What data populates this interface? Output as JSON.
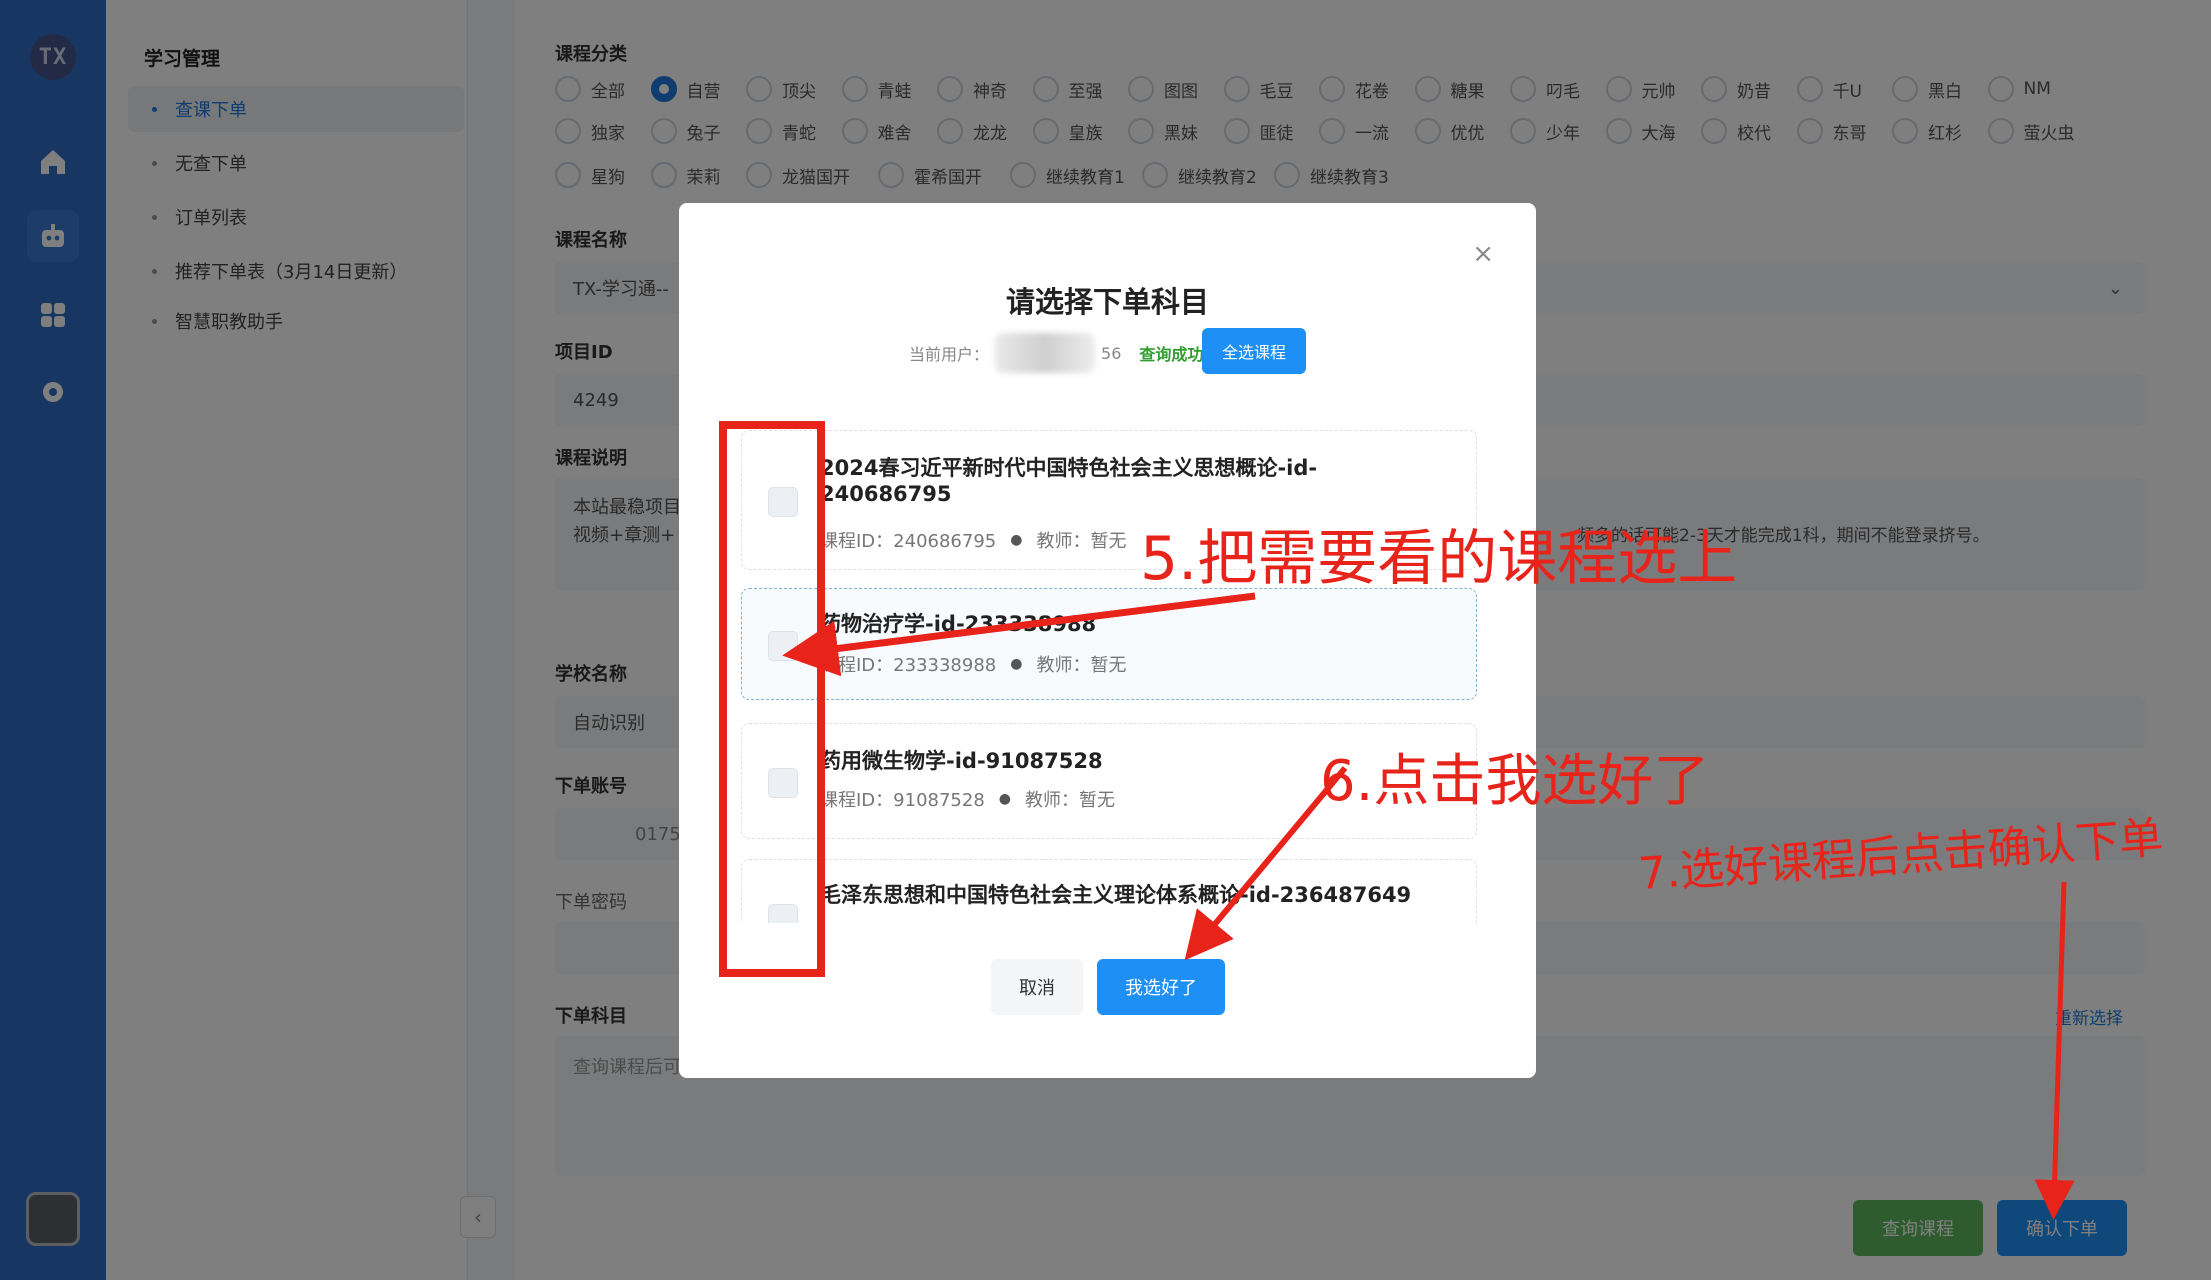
{
  "rail": {
    "logo_text": "TX",
    "icons": [
      "home-icon",
      "robot-icon",
      "grid-icon",
      "gear-icon"
    ]
  },
  "sidebar": {
    "title": "学习管理",
    "items": [
      {
        "label": "查课下单",
        "active": true
      },
      {
        "label": "无查下单",
        "active": false
      },
      {
        "label": "订单列表",
        "active": false
      },
      {
        "label": "推荐下单表（3月14日更新）",
        "active": false
      },
      {
        "label": "智慧职教助手",
        "active": false
      }
    ]
  },
  "main": {
    "category_label": "课程分类",
    "categories_row1": [
      "全部",
      "自营",
      "顶尖",
      "青蛙",
      "神奇",
      "至强",
      "图图",
      "毛豆",
      "花卷",
      "糖果",
      "叼毛",
      "元帅",
      "奶昔",
      "千U",
      "黑白",
      "NM"
    ],
    "categories_row2": [
      "独家",
      "兔子",
      "青蛇",
      "难舍",
      "龙龙",
      "皇族",
      "黑妹",
      "匪徒",
      "一流",
      "优优",
      "少年",
      "大海",
      "校代",
      "东哥",
      "红杉",
      "萤火虫"
    ],
    "categories_row3": [
      "星狗",
      "茉莉",
      "龙猫国开",
      "霍希国开",
      "继续教育1",
      "继续教育2",
      "继续教育3"
    ],
    "selected_category": "自营",
    "course_name_label": "课程名称",
    "course_name_value": "TX-学习通--",
    "project_id_label": "项目ID",
    "project_id_value": "4249",
    "desc_label": "课程说明",
    "desc_line1": "本站最稳项目",
    "desc_line2": "视频+章测+",
    "desc_tail": "频多的话可能2-3天才能完成1科，期间不能登录挤号。",
    "school_label": "学校名称",
    "school_value": "自动识别",
    "account_label": "下单账号",
    "account_partial": "0175",
    "password_label": "下单密码",
    "subject_label": "下单科目",
    "subject_placeholder": "查询课程后可",
    "reselect_link": "重新选择",
    "query_button": "查询课程",
    "order_button": "确认下单"
  },
  "modal": {
    "title": "请选择下单科目",
    "user_prefix": "当前用户：",
    "user_suffix": "56",
    "status": "查询成功",
    "select_all": "全选课程",
    "courses": [
      {
        "name": "2024春习近平新时代中国特色社会主义思想概论-id-240686795",
        "meta_id": "课程ID：240686795",
        "teacher": "教师：暂无"
      },
      {
        "name": "药物治疗学-id-233338988",
        "meta_id": "课程ID：233338988",
        "teacher": "教师：暂无"
      },
      {
        "name": "药用微生物学-id-91087528",
        "meta_id": "课程ID：91087528",
        "teacher": "教师：暂无"
      },
      {
        "name": "毛泽东思想和中国特色社会主义理论体系概论-id-236487649",
        "meta_id": "",
        "teacher": ""
      }
    ],
    "cancel": "取消",
    "confirm": "我选好了",
    "close_icon": "close-icon"
  },
  "annotations": {
    "step5": "5.把需要看的课程选上",
    "step6": "6.点击我选好了",
    "step7": "7.选好课程后点击确认下单",
    "color": "#e8231a"
  }
}
